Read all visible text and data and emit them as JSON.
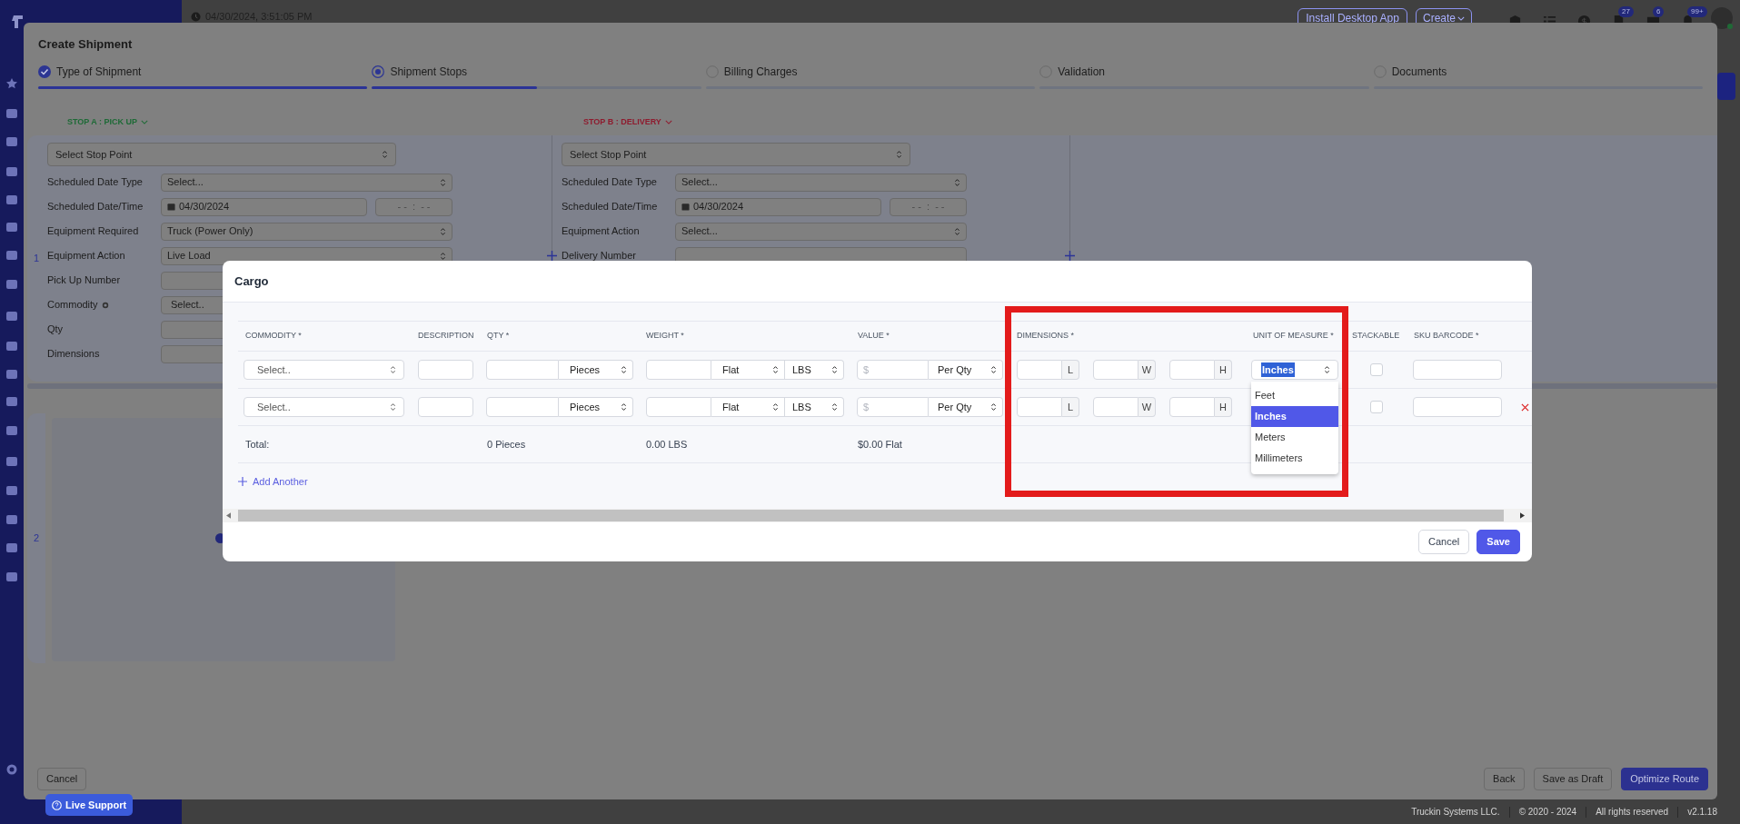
{
  "app": {
    "timestamp": "04/30/2024, 3:51:05 PM",
    "install_button": "Install Desktop App",
    "create_button": "Create",
    "toolbar_icons": [
      {
        "kind": "box"
      },
      {
        "kind": "tasks"
      },
      {
        "kind": "dollar"
      },
      {
        "kind": "document",
        "badge": "27"
      },
      {
        "kind": "message",
        "badge": "6"
      },
      {
        "kind": "bell",
        "badge": "99+"
      }
    ],
    "footer": [
      "Truckin Systems LLC.",
      "© 2020 - 2024",
      "All rights reserved",
      "v2.1.18"
    ],
    "live_support": "Live Support"
  },
  "create_shipment": {
    "title": "Create Shipment",
    "steps": [
      {
        "label": "Type of Shipment",
        "checked": true,
        "selected": false,
        "level": 1
      },
      {
        "label": "Shipment Stops",
        "checked": false,
        "selected": true,
        "level": 0.5
      },
      {
        "label": "Billing Charges",
        "checked": false,
        "selected": false,
        "level": 0
      },
      {
        "label": "Validation",
        "checked": false,
        "selected": false,
        "level": 0
      },
      {
        "label": "Documents",
        "checked": false,
        "selected": false,
        "level": 0
      }
    ],
    "row_numbers": [
      "1",
      "2"
    ],
    "stops": [
      {
        "label": "STOP A : PICK UP",
        "color": "#1e6a36",
        "stop_point": "Select Stop Point",
        "fields": [
          {
            "label": "Scheduled Date Type",
            "kind": "select",
            "value": "Select..."
          },
          {
            "label": "Scheduled Date/Time",
            "kind": "datetime",
            "value": "04/30/2024",
            "time": "- -  :  - -"
          },
          {
            "label": "Equipment Required",
            "kind": "select",
            "value": "Truck (Power Only)"
          },
          {
            "label": "Equipment Action",
            "kind": "select",
            "value": "Live Load"
          },
          {
            "label": "Pick Up Number",
            "kind": "input"
          },
          {
            "label": "Commodity",
            "kind": "picker",
            "value": "Select..",
            "gear": true
          },
          {
            "label": "Qty",
            "kind": "input"
          },
          {
            "label": "Dimensions",
            "kind": "input"
          }
        ]
      },
      {
        "label": "STOP B : DELIVERY",
        "color": "#8e1b2e",
        "stop_point": "Select Stop Point",
        "fields": [
          {
            "label": "Scheduled Date Type",
            "kind": "select",
            "value": "Select..."
          },
          {
            "label": "Scheduled Date/Time",
            "kind": "datetime",
            "value": "04/30/2024",
            "time": "- -  :  - -"
          },
          {
            "label": "Equipment Action",
            "kind": "select",
            "value": "Select..."
          },
          {
            "label": "Delivery Number",
            "kind": "input"
          }
        ]
      }
    ],
    "buttons": [
      {
        "kind": "cancel",
        "label": "Cancel"
      },
      {
        "kind": "plain",
        "label": "Back"
      },
      {
        "kind": "plain",
        "label": "Save as Draft"
      },
      {
        "kind": "primary",
        "label": "Optimize Route"
      }
    ]
  },
  "cargo": {
    "title": "Cargo",
    "columns": [
      "COMMODITY *",
      "DESCRIPTION",
      "QTY *",
      "WEIGHT *",
      "VALUE *",
      "DIMENSIONS *",
      "UNIT OF MEASURE *",
      "STACKABLE",
      "SKU BARCODE *"
    ],
    "rows": [
      {
        "commodity": "Select..",
        "qty_unit": "Pieces",
        "weight_type": "Flat",
        "weight_unit": "LBS",
        "value_placeholder": "$",
        "value_type": "Per Qty",
        "dimension_suffixes": [
          "L",
          "W",
          "H"
        ],
        "unit": "Inches",
        "unit_options": [
          {
            "label": "Feet",
            "selected": false
          },
          {
            "label": "Inches",
            "selected": true
          },
          {
            "label": "Meters",
            "selected": false
          },
          {
            "label": "Millimeters",
            "selected": false
          }
        ],
        "stackable": false,
        "removable": false
      },
      {
        "commodity": "Select..",
        "qty_unit": "Pieces",
        "weight_type": "Flat",
        "weight_unit": "LBS",
        "value_placeholder": "$",
        "value_type": "Per Qty",
        "dimension_suffixes": [
          "L",
          "W",
          "H"
        ],
        "stackable": false,
        "removable": true
      }
    ],
    "totals": {
      "label": "Total:",
      "qty": "0 Pieces",
      "weight": "0.00 LBS",
      "value": "$0.00 Flat"
    },
    "add_another": "Add Another",
    "annotation": {
      "kind": "rectangle"
    },
    "buttons": [
      {
        "kind": "cancel",
        "label": "Cancel"
      },
      {
        "kind": "primary",
        "label": "Save"
      }
    ]
  }
}
